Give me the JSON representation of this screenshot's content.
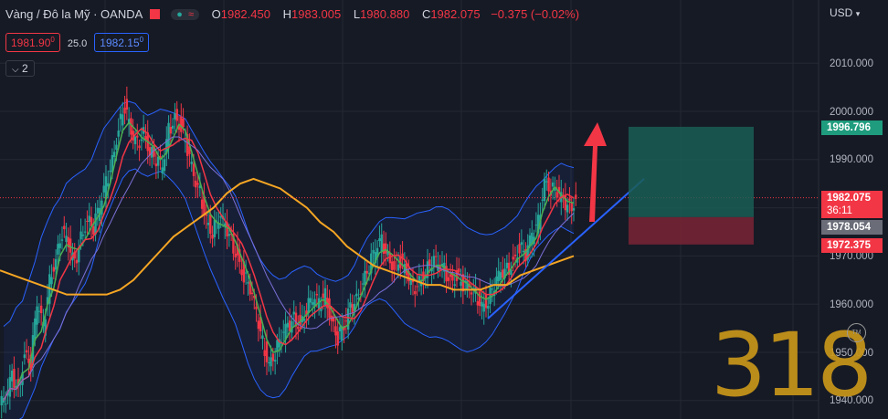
{
  "header": {
    "symbol": "Vàng / Đô la Mỹ · OANDA",
    "open_label": "O",
    "open": "1982.450",
    "high_label": "H",
    "high": "1983.005",
    "low_label": "L",
    "low": "1980.880",
    "close_label": "C",
    "close": "1982.075",
    "change": "−0.375 (−0.02%)"
  },
  "order_panel": {
    "sell_price": "1981.90",
    "sell_sup": "0",
    "spread": "25.0",
    "buy_price": "1982.15",
    "buy_sup": "0"
  },
  "indicators_button": {
    "label": "2",
    "icon": "chevron-down-icon"
  },
  "axis": {
    "currency": "USD",
    "ticks": [
      "2010.000",
      "2000.000",
      "1990.000",
      "1970.000",
      "1960.000",
      "1950.000",
      "1940.000"
    ]
  },
  "price_tags": {
    "take_profit": "1996.796",
    "current": "1982.075",
    "countdown": "36:11",
    "entry": "1978.054",
    "stop_loss": "1972.375"
  },
  "watermark": {
    "text": "318",
    "mark": "TM"
  },
  "colors": {
    "background": "#161a25",
    "up": "#26a69a",
    "down": "#f23645",
    "ma_fast_red": "#f23645",
    "ma_fast_green": "#4caf50",
    "ma_slow": "#f5a623",
    "bands": "#2962ff",
    "profit_zone": "#1a5e55",
    "loss_zone": "#7a2535",
    "arrow": "#f23645"
  },
  "chart_data": {
    "type": "candlestick",
    "y_range": [
      1938,
      2018
    ],
    "current_price": 1982.075,
    "close_path": [
      1940,
      1945,
      1942,
      1950,
      1948,
      1960,
      1955,
      1965,
      1970,
      1975,
      1972,
      1968,
      1974,
      1978,
      1976,
      1980,
      1985,
      1990,
      1997,
      2001,
      1995,
      1993,
      1996,
      1992,
      1990,
      1988,
      1996,
      1999,
      1997,
      1992,
      1986,
      1983,
      1978,
      1975,
      1978,
      1976,
      1973,
      1970,
      1966,
      1963,
      1958,
      1952,
      1948,
      1950,
      1953,
      1955,
      1957,
      1956,
      1959,
      1961,
      1960,
      1962,
      1957,
      1953,
      1955,
      1959,
      1961,
      1965,
      1968,
      1971,
      1973,
      1970,
      1968,
      1969,
      1966,
      1963,
      1965,
      1967,
      1969,
      1968,
      1967,
      1965,
      1966,
      1964,
      1963,
      1962,
      1960,
      1961,
      1964,
      1966,
      1967,
      1969,
      1972,
      1970,
      1974,
      1977,
      1986,
      1984,
      1983,
      1981,
      1980,
      1982
    ],
    "ma_slow": [
      1967,
      1966,
      1965,
      1964,
      1963,
      1962,
      1962,
      1962,
      1962,
      1963,
      1965,
      1968,
      1971,
      1974,
      1976,
      1978,
      1980,
      1983,
      1985,
      1986,
      1985,
      1984,
      1982,
      1980,
      1977,
      1975,
      1972,
      1970,
      1968,
      1967,
      1966,
      1965,
      1964,
      1964,
      1963,
      1963,
      1963,
      1964,
      1964,
      1966,
      1967,
      1968,
      1969,
      1970
    ],
    "trendline": {
      "from": 1957,
      "to": 1986
    },
    "position": {
      "take_profit": 1996.796,
      "entry": 1978.054,
      "stop_loss": 1972.375
    }
  }
}
